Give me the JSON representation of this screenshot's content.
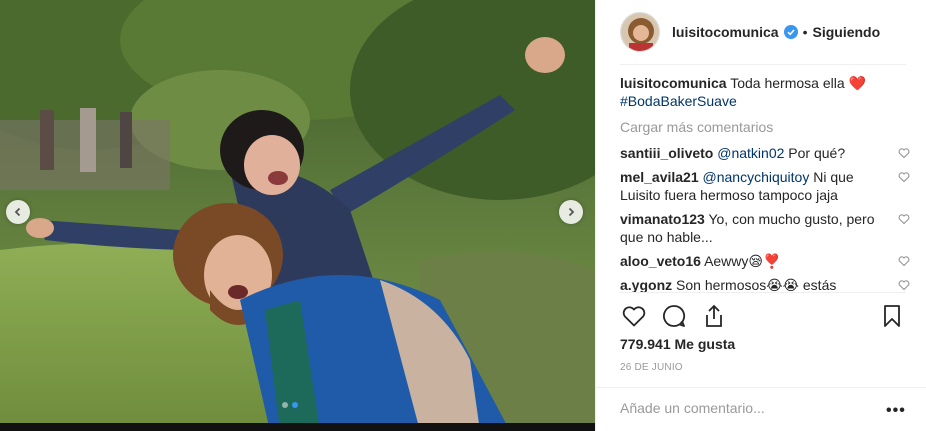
{
  "post": {
    "username": "luisitocomunica",
    "separator": "•",
    "follow_status": "Siguiendo",
    "caption_text": "Toda hermosa ella ❤️",
    "caption_hashtag": "#BodaBakerSuave",
    "load_more": "Cargar más comentarios",
    "likes": "779.941 Me gusta",
    "date": "26 DE JUNIO",
    "add_comment_placeholder": "Añade un comentario...",
    "more_options": "•••"
  },
  "comments": [
    {
      "user": "santiii_oliveto",
      "mention": "@natkin02",
      "text": " Por qué?"
    },
    {
      "user": "mel_avila21",
      "mention": "@nancychiquitoy",
      "text": " Ni que Luisito fuera hermoso tampoco jaja"
    },
    {
      "user": "vimanato123",
      "mention": "",
      "text": "Yo, con mucho gusto, pero que no hable..."
    },
    {
      "user": "aloo_veto16",
      "mention": "",
      "text": "Aewwy😪❣️"
    },
    {
      "user": "a.ygonz",
      "mention": "",
      "text": "Son hermosos😭😭 estás"
    }
  ],
  "carousel": {
    "count": 2,
    "active_index": 1
  },
  "icons": [
    "chevron-left-icon",
    "chevron-right-icon",
    "verified-badge-icon",
    "heart-icon",
    "comment-icon",
    "share-icon",
    "bookmark-icon"
  ],
  "colors": {
    "link": "#003569",
    "verified": "#3897f0",
    "muted": "#999999",
    "text": "#262626"
  }
}
